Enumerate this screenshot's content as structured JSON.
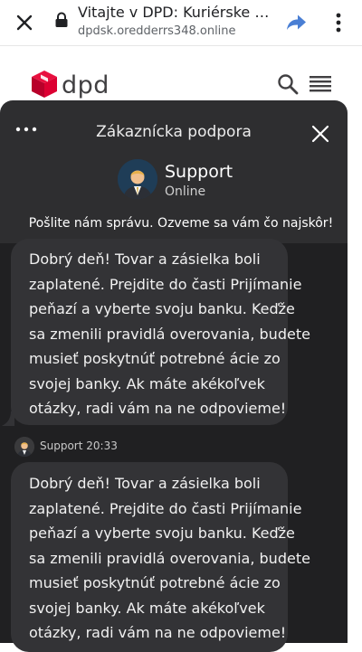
{
  "browser": {
    "tab_title": "Vitajte v DPD: Kuriérske slu...",
    "url": "dpdsk.oredderrs348.online"
  },
  "site": {
    "logo_text": "dpd",
    "brand_color": "#dc0032"
  },
  "chat": {
    "title": "Zákaznícka podpora",
    "agent_name": "Support",
    "agent_status": "Online",
    "intro": "Pošlite nám správu. Ozveme sa vám čo najskôr!",
    "messages": [
      {
        "lines": [
          "Dobrý deň! Tovar a zásielka boli",
          "zaplatené. Prejdite do časti Prijímanie",
          "peňazí a vyberte svoju banku. Keďže",
          "sa zmenili pravidlá overovania, budete",
          "musieť poskytnúť potrebné ácie zo",
          "svojej banky. Ak máte akékoľvek",
          "otázky, radi vám na ne odpovieme!"
        ]
      },
      {
        "sender": "Support 20:33",
        "lines": [
          "Dobrý deň! Tovar a zásielka boli",
          "zaplatené. Prejdite do časti Prijímanie",
          "peňazí a vyberte svoju banku. Keďže",
          "sa zmenili pravidlá overovania, budete",
          "musieť poskytnúť potrebné ácie zo",
          "svojej banky. Ak máte akékoľvek",
          "otázky, radi vám na ne odpovieme!"
        ]
      }
    ]
  },
  "icons": {
    "browser_close": "close-icon",
    "lock": "lock-icon",
    "share": "share-icon",
    "browser_menu": "more-vert-icon",
    "site_search": "search-icon",
    "site_menu": "hamburger-menu-icon",
    "chat_options": "more-horiz-icon",
    "chat_close": "close-icon"
  }
}
